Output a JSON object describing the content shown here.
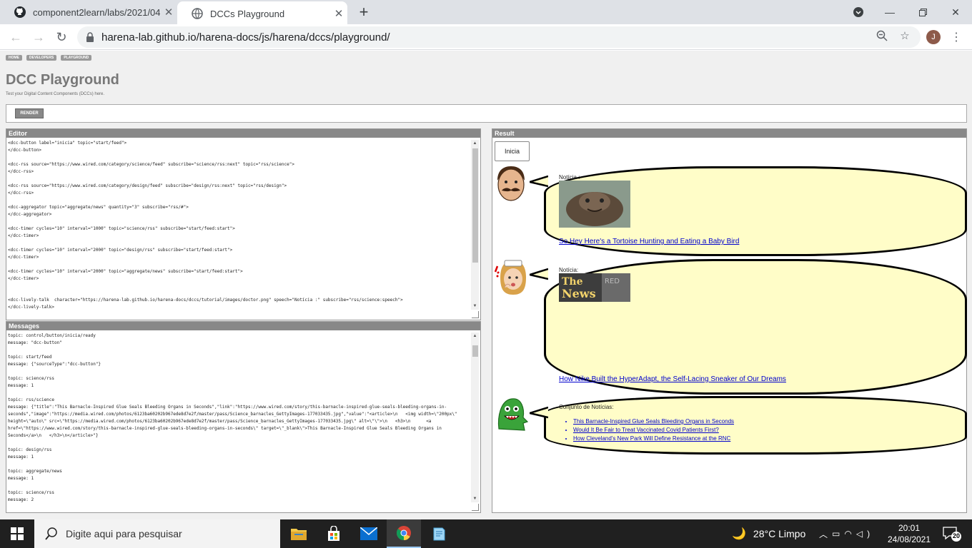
{
  "browser": {
    "tabs": [
      {
        "title": "component2learn/labs/2021/04-"
      },
      {
        "title": "DCCs Playground"
      }
    ],
    "url": "harena-lab.github.io/harena-docs/js/harena/dccs/playground/",
    "avatar_letter": "J"
  },
  "page": {
    "breadcrumb": [
      "HOME",
      "DEVELOPERS",
      "PLAYGROUND"
    ],
    "title": "DCC Playground",
    "subtitle": "Test your Digital Content Components (DCCs) here.",
    "render_label": "RENDER"
  },
  "editor": {
    "title": "Editor",
    "lines": [
      "<dcc-button label=\"inicia\" topic=\"start/feed\">",
      "</dcc-button>",
      "",
      "<dcc-rss source=\"https://www.wired.com/category/science/feed\" subscribe=\"science/rss:next\" topic=\"rss/science\">",
      "</dcc-rss>",
      "",
      "<dcc-rss source=\"https://www.wired.com/category/design/feed\" subscribe=\"design/rss:next\" topic=\"rss/design\">",
      "</dcc-rss>",
      "",
      "<dcc-aggregator topic=\"aggregate/news\" quantity=\"3\" subscribe=\"rss/#\">",
      "</dcc-aggregator>",
      "",
      "<dcc-timer cycles=\"10\" interval=\"1000\" topic=\"science/rss\" subscribe=\"start/feed:start\">",
      "</dcc-timer>",
      "",
      "<dcc-timer cycles=\"10\" interval=\"2000\" topic=\"design/rss\" subscribe=\"start/feed:start\">",
      "</dcc-timer>",
      "",
      "<dcc-timer cycles=\"10\" interval=\"2000\" topic=\"aggregate/news\" subscribe=\"start/feed:start\">",
      "</dcc-timer>",
      "",
      "",
      "<dcc-lively-talk  character=\"https://harena-lab.github.io/harena-docs/dccs/tutorial/images/doctor.png\" speech=\"Notícia :\" subscribe=\"rss/science:speech\">",
      "</dcc-lively-talk>"
    ]
  },
  "messages": {
    "title": "Messages",
    "lines": [
      "topic: control/button/inicia/ready",
      "message: \"dcc-button\"",
      "",
      "topic: start/feed",
      "message: {\"sourceType\":\"dcc-button\"}",
      "",
      "topic: science/rss",
      "message: 1",
      "",
      "topic: rss/science",
      "message: {\"title\":\"This Barnacle-Inspired Glue Seals Bleeding Organs in Seconds\",\"link\":\"https://www.wired.com/story/this-barnacle-inspired-glue-seals-bleeding-organs-in-",
      "seconds\",\"image\":\"https://media.wired.com/photos/6123ba60202b967ede8d7e2f/master/pass/Science_barnacles_GettyImages-177033435.jpg\",\"value\":\"<article>\\n   <img width=\\\"200px\\\"",
      "height=\\\"auto\\\" src=\\\"https://media.wired.com/photos/6123ba60202b967ede8d7e2f/master/pass/Science_barnacles_GettyImages-177033435.jpg\\\" alt=\\\"\\\">\\n   <h3>\\n      <a",
      "href=\\\"https://www.wired.com/story/this-barnacle-inspired-glue-seals-bleeding-organs-in-seconds\\\" target=\\\"_blank\\\">This Barnacle-Inspired Glue Seals Bleeding Organs in",
      "Seconds</a>\\n   </h3>\\n</article>\"}",
      "",
      "topic: design/rss",
      "message: 1",
      "",
      "topic: aggregate/news",
      "message: 1",
      "",
      "topic: science/rss",
      "message: 2"
    ]
  },
  "result": {
    "title": "Result",
    "inicia_label": "Inicia",
    "talk1": {
      "label": "Notícia :",
      "link": "So Hey Here's a Tortoise Hunting and Eating a Baby Bird"
    },
    "talk2": {
      "label": "Notícia:",
      "link": "How Nike Built the HyperAdapt, the Self-Lacing Sneaker of Our Dreams"
    },
    "talk3": {
      "label": "Conjunto de Notícias:",
      "items": [
        "This Barnacle-Inspired Glue Seals Bleeding Organs in Seconds",
        "Would It Be Fair to Treat Vaccinated Covid Patients First?",
        "How Cleveland's New Park Will Define Resistance at the RNC"
      ]
    }
  },
  "taskbar": {
    "search_placeholder": "Digite aqui para pesquisar",
    "weather": "28°C  Limpo",
    "time": "20:01",
    "date": "24/08/2021",
    "notifications": "20"
  }
}
